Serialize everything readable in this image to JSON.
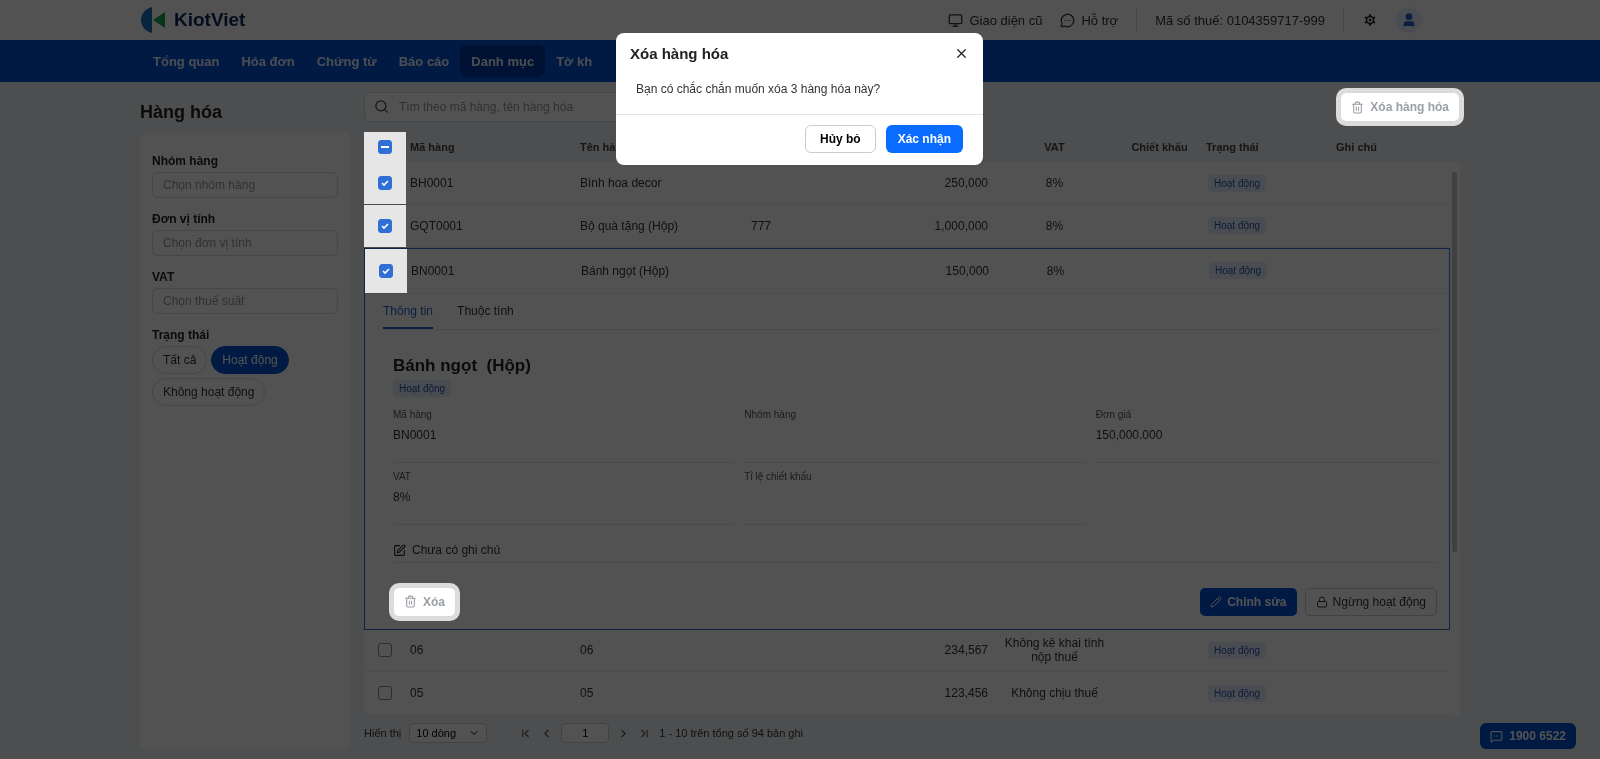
{
  "header": {
    "logo_text": "KiotViet",
    "links": [
      {
        "kind": "monitor",
        "label": "Giao diện cũ"
      },
      {
        "kind": "chat",
        "label": "Hỗ trợ"
      }
    ],
    "tax_code": "Mã số thuế: 0104359717-999"
  },
  "nav": [
    {
      "label": "Tổng quan",
      "selected": false
    },
    {
      "label": "Hóa đơn",
      "selected": false
    },
    {
      "label": "Chứng từ",
      "selected": false
    },
    {
      "label": "Báo cáo",
      "selected": false
    },
    {
      "label": "Danh mục",
      "selected": true
    },
    {
      "label": "Tờ kh",
      "selected": false
    }
  ],
  "page_title": "Hàng hóa",
  "filters": {
    "fields": [
      {
        "label": "Nhóm hàng",
        "placeholder": "Chọn nhóm hàng"
      },
      {
        "label": "Đơn vị tính",
        "placeholder": "Chọn đơn vị tính"
      },
      {
        "label": "VAT",
        "placeholder": "Chọn thuế suất"
      }
    ],
    "status_label": "Trạng thái",
    "status_options": [
      {
        "label": "Tất cả",
        "selected": false
      },
      {
        "label": "Hoạt động",
        "selected": true
      },
      {
        "label": "Không hoạt động",
        "selected": false
      }
    ]
  },
  "search": {
    "placeholder": "Tìm theo mã hàng, tên hàng hóa"
  },
  "delete_selected_button": {
    "label": "Xóa hàng hóa",
    "spotlight": true
  },
  "table": {
    "select_all": {
      "indeterminate": true,
      "spotlight": true
    },
    "columns": [
      {
        "label": "Mã hàng"
      },
      {
        "label": "Tên hà"
      },
      {},
      {},
      {
        "label": "VAT"
      },
      {
        "label": "Chiết khấu"
      },
      {
        "label": "Trạng thái"
      },
      {
        "label": "Ghi chú"
      }
    ],
    "rows": [
      {
        "checked": true,
        "spotlight": true,
        "expanded": false,
        "code": "BH0001",
        "name": "Bình hoa decor",
        "price": "250,000",
        "vat": "8%",
        "status": "Hoạt động"
      },
      {
        "checked": true,
        "spotlight": true,
        "expanded": false,
        "code": "GQT0001",
        "name": "Bộ quà tặng (Hộp)",
        "column_3": "777",
        "price": "1,000,000",
        "vat": "8%",
        "status": "Hoạt động"
      },
      {
        "checked": true,
        "spotlight": true,
        "expanded": true,
        "code": "BN0001",
        "name": "Bánh ngọt (Hộp)",
        "price": "150,000",
        "vat": "8%",
        "status": "Hoạt động"
      },
      {
        "checked": false,
        "spotlight": false,
        "expanded": false,
        "code": "06",
        "name": "06",
        "price": "234,567",
        "vat": "Không kê khai tính nộp thuế",
        "status": "Hoạt động"
      },
      {
        "checked": false,
        "spotlight": false,
        "expanded": false,
        "code": "05",
        "name": "05",
        "price": "123,456",
        "vat": "Không chịu thuế",
        "status": "Hoạt động"
      }
    ],
    "detail": {
      "tabs": [
        {
          "label": "Thông tin",
          "selected": true
        },
        {
          "label": "Thuộc tính",
          "selected": false
        }
      ],
      "title": "Bánh ngọt  (Hộp)",
      "status": "Hoạt động",
      "fields": [
        {
          "label": "Mã hàng",
          "value": "BN0001"
        },
        {
          "label": "Nhóm hàng"
        },
        {
          "label": "Đơn giá",
          "value": "150,000.000"
        },
        {
          "label": "VAT",
          "value": "8%"
        },
        {
          "label": "Tỉ lệ chiết khấu"
        }
      ],
      "note": "Chưa có ghi chú",
      "delete_button": {
        "label": "Xóa",
        "spotlight": true
      },
      "edit_button": "Chỉnh sửa",
      "deactivate_button": "Ngừng hoạt động"
    }
  },
  "pagination": {
    "label": "Hiển thị",
    "page_size": "10 dòng",
    "page": "1",
    "summary": "1 - 10 trên tổng số 94 bản ghi"
  },
  "hotline": "1900 6522",
  "modal": {
    "title": "Xóa hàng hóa",
    "message": "Bạn có chắc chắn muốn xóa 3 hàng hóa này?",
    "cancel": "Hủy bỏ",
    "confirm": "Xác nhận"
  }
}
